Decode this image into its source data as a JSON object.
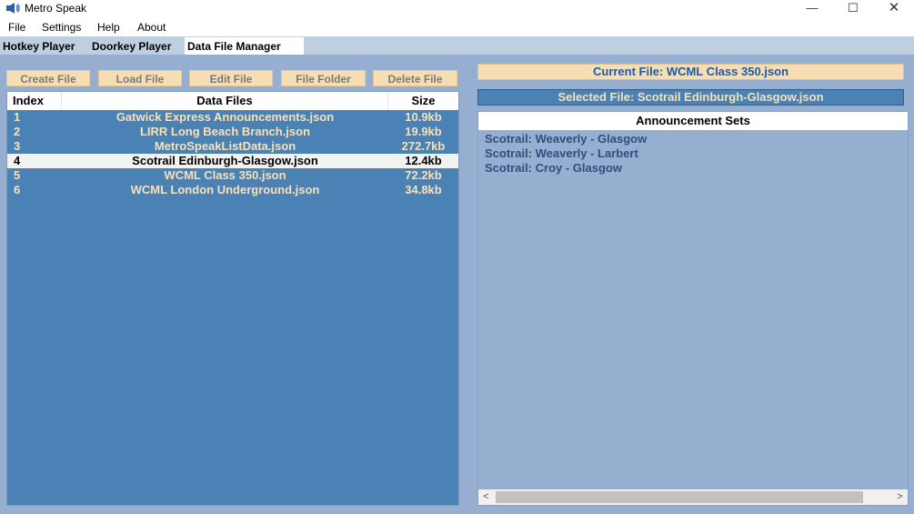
{
  "window": {
    "title": "Metro Speak",
    "icon": "speaker-icon",
    "controls": {
      "minimize": "—",
      "maximize": "☐",
      "close": "✕"
    }
  },
  "menu": [
    "File",
    "Settings",
    "Help",
    "About"
  ],
  "tabs": [
    {
      "label": "Hotkey Player",
      "active": false
    },
    {
      "label": "Doorkey Player",
      "active": false
    },
    {
      "label": "Data File Manager",
      "active": true
    }
  ],
  "buttons": {
    "create": "Create File",
    "load": "Load File",
    "edit": "Edit File",
    "folder": "File Folder",
    "delete": "Delete File"
  },
  "file_list": {
    "columns": [
      "Index",
      "Data Files",
      "Size"
    ],
    "rows": [
      {
        "index": "1",
        "file": "Gatwick Express Announcements.json",
        "size": "10.9kb",
        "selected": false
      },
      {
        "index": "2",
        "file": "LIRR Long Beach Branch.json",
        "size": "19.9kb",
        "selected": false
      },
      {
        "index": "3",
        "file": "MetroSpeakListData.json",
        "size": "272.7kb",
        "selected": false
      },
      {
        "index": "4",
        "file": "Scotrail Edinburgh-Glasgow.json",
        "size": "12.4kb",
        "selected": true
      },
      {
        "index": "5",
        "file": "WCML Class 350.json",
        "size": "72.2kb",
        "selected": false
      },
      {
        "index": "6",
        "file": "WCML London Underground.json",
        "size": "34.8kb",
        "selected": false
      }
    ]
  },
  "current_file": "Current File: WCML Class 350.json",
  "selected_file": "Selected File: Scotrail Edinburgh-Glasgow.json",
  "announcement_sets": {
    "header": "Announcement Sets",
    "items": [
      "Scotrail: Weaverly - Glasgow",
      "Scotrail: Weaverly - Larbert",
      "Scotrail: Croy - Glasgow"
    ],
    "scroll_left": "<",
    "scroll_right": ">"
  },
  "colors": {
    "panel_bg": "#96aed0",
    "list_bg": "#4a82b5",
    "button_bg": "#f7ddb4",
    "row_text": "#f7e1b8",
    "current_file_text": "#1e5aa8"
  }
}
